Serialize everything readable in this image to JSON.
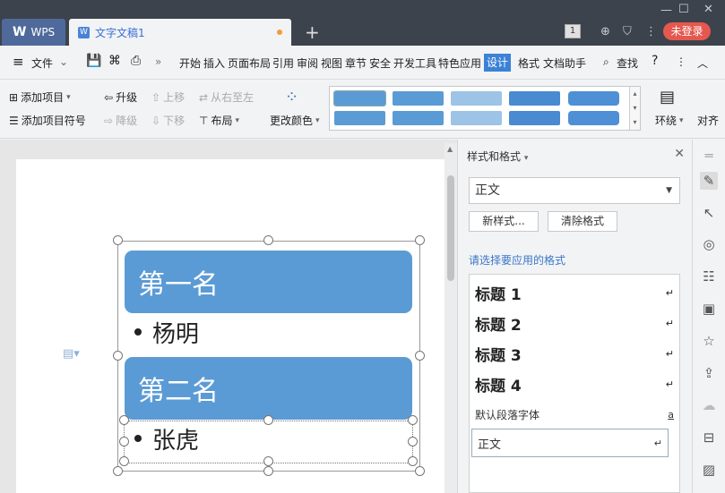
{
  "titlebar": {
    "app_tab": "WPS",
    "doc_tab": "文字文稿1",
    "page_badge": "1",
    "login": "未登录"
  },
  "menubar": {
    "file": "文件",
    "items": [
      "开始",
      "插入",
      "页面布局",
      "引用",
      "审阅",
      "视图",
      "章节",
      "安全",
      "开发工具",
      "特色应用",
      "设计",
      "格式",
      "文档助手"
    ],
    "active": "设计",
    "search": "查找"
  },
  "ribbon": {
    "add_item": "添加项目",
    "add_bullet": "添加项目符号",
    "promote": "升级",
    "demote": "降级",
    "move_up": "上移",
    "move_down": "下移",
    "rtl": "从右至左",
    "layout": "布局",
    "change_color": "更改颜色",
    "wrap": "环绕",
    "align": "对齐",
    "swatch_colors": [
      "#5b9bd5",
      "#5b9bd5",
      "#9dc3e6",
      "#5b9bd5",
      "#5b9bd5"
    ]
  },
  "document": {
    "level1_a": "第一名",
    "bullet_a": "杨明",
    "level1_b": "第二名",
    "bullet_b": "张虎",
    "accent": "#5b9bd5"
  },
  "panel": {
    "title": "样式和格式",
    "current_style": "正文",
    "new_style": "新样式...",
    "clear_format": "清除格式",
    "apply_label": "请选择要应用的格式",
    "styles": [
      "标题 1",
      "标题 2",
      "标题 3",
      "标题 4",
      "默认段落字体",
      "正文"
    ]
  }
}
